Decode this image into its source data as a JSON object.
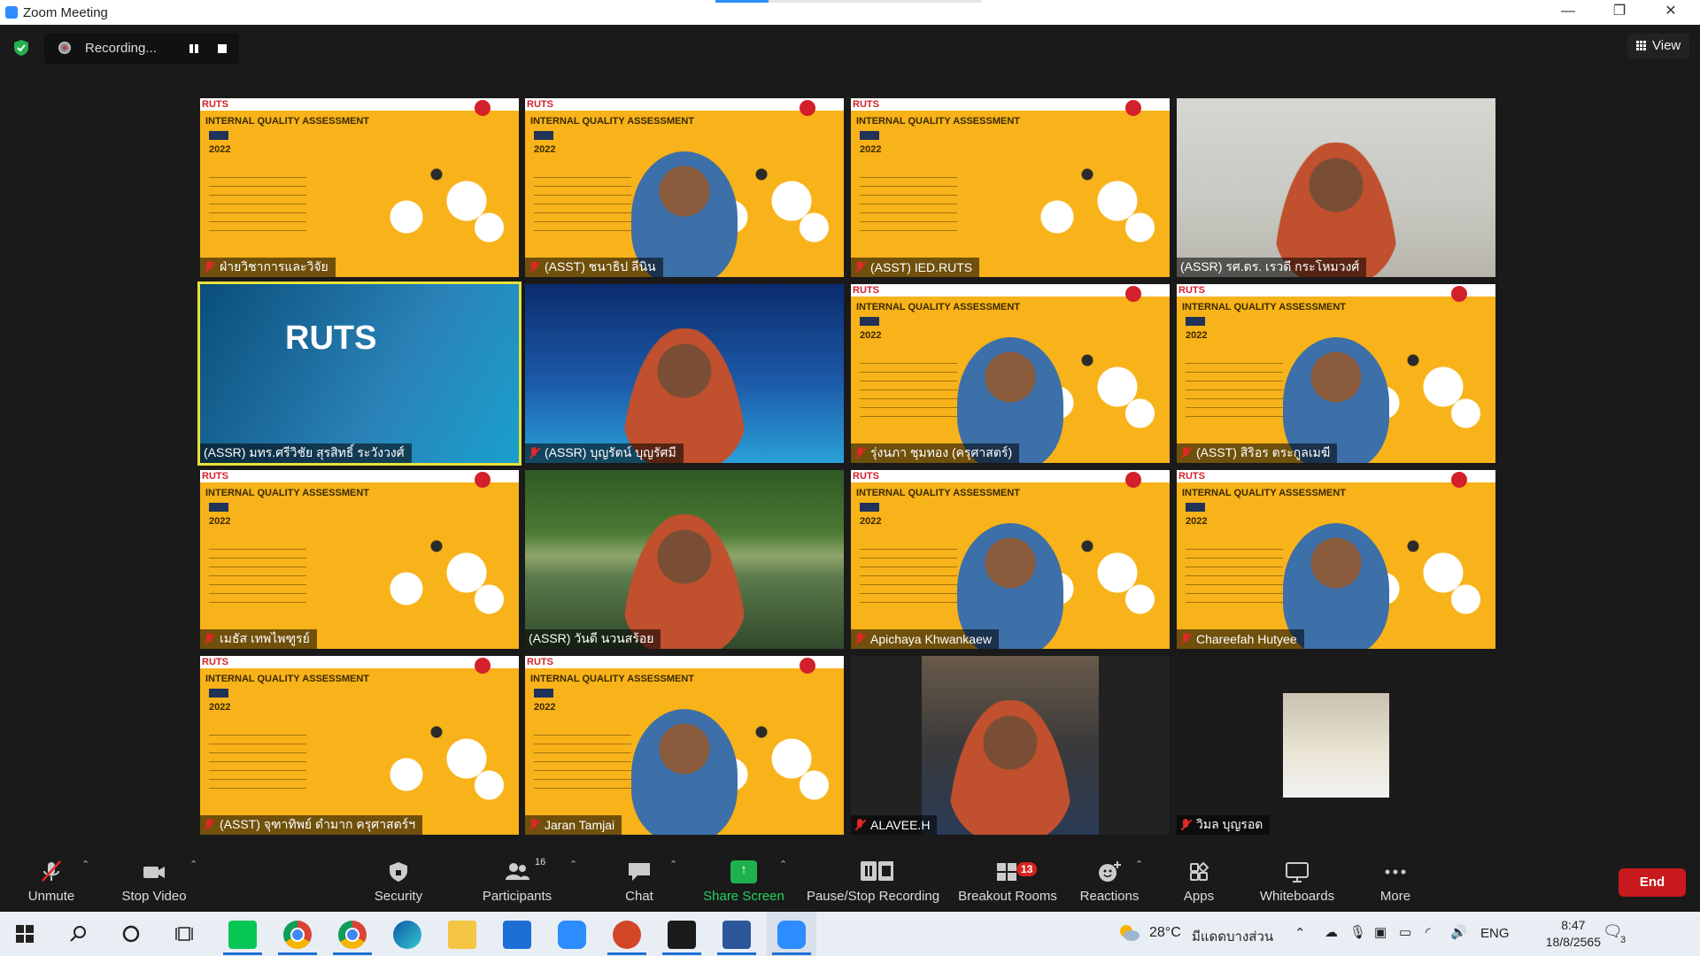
{
  "window": {
    "title": "Zoom Meeting"
  },
  "recording": {
    "label": "Recording..."
  },
  "view_button": {
    "label": "View"
  },
  "participants_tiles": [
    {
      "name": "ฝ่ายวิชาการและวิจัย",
      "muted": true,
      "kind": "slide"
    },
    {
      "name": "(ASST) ชนาธิป ลีนิน",
      "muted": true,
      "kind": "slide-person"
    },
    {
      "name": "(ASST) IED.RUTS",
      "muted": true,
      "kind": "slide"
    },
    {
      "name": "(ASSR) รศ.ดร. เรวดี กระโหมวงศ์",
      "muted": false,
      "kind": "camera"
    },
    {
      "name": "(ASSR) มทร.ศรีวิชัย สุรสิทธิ์ ระวังวงศ์",
      "muted": false,
      "kind": "banner",
      "active": true
    },
    {
      "name": "(ASSR) บุญรัตน์ บุญรัศมี",
      "muted": true,
      "kind": "banner-blue"
    },
    {
      "name": "รุ่งนภา ชุมทอง (ครุศาสตร์)",
      "muted": true,
      "kind": "slide-person"
    },
    {
      "name": "(ASST) สิริอร ตระกูลเมฆี",
      "muted": true,
      "kind": "slide-person"
    },
    {
      "name": "เมธัส เทพไพฑูรย์",
      "muted": true,
      "kind": "slide"
    },
    {
      "name": "(ASSR) วันดี นวนสร้อย",
      "muted": false,
      "kind": "lake"
    },
    {
      "name": "Apichaya Khwankaew",
      "muted": true,
      "kind": "slide-person"
    },
    {
      "name": "Chareefah Hutyee",
      "muted": true,
      "kind": "slide-person"
    },
    {
      "name": "(ASST) จุฑาทิพย์ ดำมาก ครุศาสตร์ฯ",
      "muted": true,
      "kind": "slide"
    },
    {
      "name": "Jaran Tamjai",
      "muted": true,
      "kind": "slide-person"
    },
    {
      "name": "ALAVEE.H",
      "muted": true,
      "kind": "portrait"
    },
    {
      "name": "วิมล บุญรอด",
      "muted": true,
      "kind": "small-photo"
    }
  ],
  "slide_text": {
    "logo": "RUTS",
    "heading": "INTERNAL QUALITY ASSESSMENT",
    "year": "2022"
  },
  "toolbar": {
    "unmute": "Unmute",
    "stop_video": "Stop Video",
    "security": "Security",
    "participants": "Participants",
    "participants_count": "16",
    "chat": "Chat",
    "share_screen": "Share Screen",
    "pause_stop_recording": "Pause/Stop Recording",
    "breakout_rooms": "Breakout Rooms",
    "breakout_badge": "13",
    "reactions": "Reactions",
    "apps": "Apps",
    "whiteboards": "Whiteboards",
    "more": "More",
    "end": "End"
  },
  "taskbar": {
    "weather": "28°C",
    "weather_text": "มีแดดบางส่วน",
    "language": "ENG",
    "time": "8:47",
    "date": "18/8/2565",
    "notification_count": "3"
  },
  "colors": {
    "zoom_blue": "#2d8cff",
    "end_red": "#c8191c",
    "slide_orange": "#f8b21a",
    "share_green": "#1eb14d"
  }
}
